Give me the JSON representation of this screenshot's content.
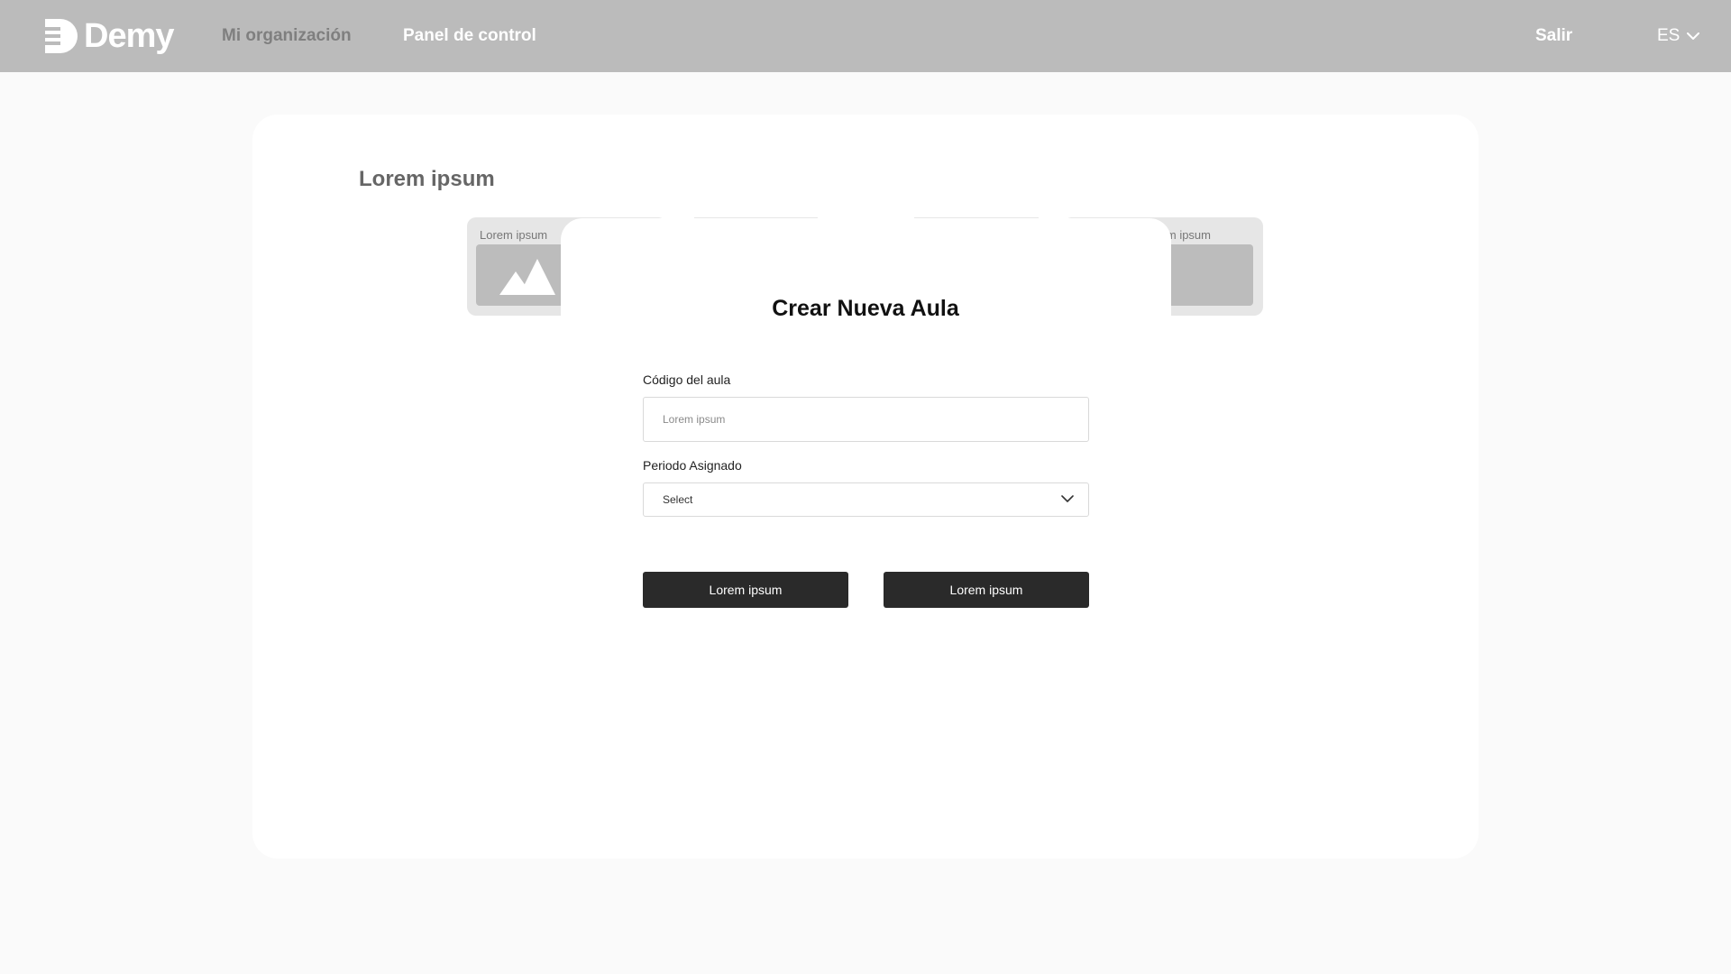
{
  "header": {
    "brand": "Demy",
    "nav": {
      "organization": "Mi organización",
      "dashboard": "Panel de control"
    },
    "logout": "Salir",
    "language": "ES"
  },
  "page": {
    "section_title": "Lorem ipsum",
    "cards": [
      {
        "label": "Lorem ipsum"
      },
      {
        "label": "m ipsum"
      }
    ]
  },
  "modal": {
    "title": "Crear Nueva Aula",
    "code_field": {
      "label": "Código del aula",
      "placeholder": "Lorem ipsum",
      "value": ""
    },
    "period_field": {
      "label": "Periodo Asignado",
      "selected": "Select"
    },
    "primary_button": "Lorem ipsum",
    "secondary_button": "Lorem ipsum"
  },
  "colors": {
    "topbar": "#bbbbbb",
    "background": "#fafafa",
    "button": "#2a2a2a",
    "placeholder_image": "#bcbcbc"
  },
  "icons": [
    "demy-logo-icon",
    "chevron-down-icon",
    "image-placeholder-icon"
  ]
}
